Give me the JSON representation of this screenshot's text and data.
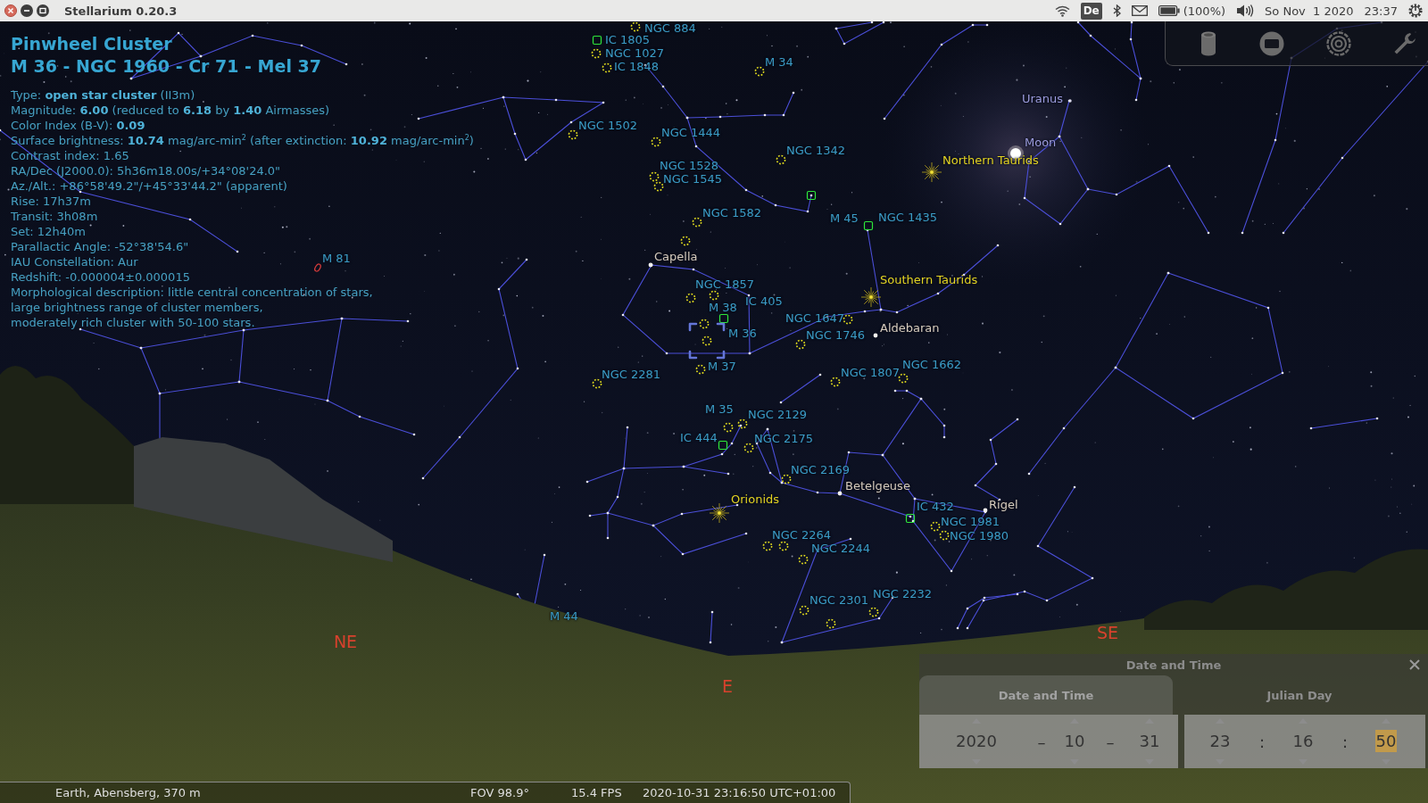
{
  "window": {
    "title": "Stellarium 0.20.3"
  },
  "system_tray": {
    "keyboard_layout": "De",
    "battery": "(100%)",
    "date": "So Nov  1 2020",
    "time": "23:37"
  },
  "object_info": {
    "title": "Pinwheel Cluster",
    "designations": "M 36 - NGC 1960 - Cr 71 - Mel 37",
    "lines": [
      "Type: **open star cluster** (II3m)",
      "Magnitude: **6.00** (reduced to **6.18** by **1.40** Airmasses)",
      "Color Index (B-V): **0.09**",
      "Surface brightness: **10.74** mag/arc-min$^{2}$ (after extinction: **10.92** mag/arc-min$^{2}$)",
      "Contrast index: 1.65",
      "RA/Dec (J2000.0): 5h36m18.00s/+34°08'24.0\"",
      "Az./Alt.: +86°58'49.2\"/+45°33'44.2\" (apparent)",
      "Rise: 17h37m",
      "Transit: 3h08m",
      "Set: 12h40m",
      "Parallactic Angle: -52°38'54.6\"",
      "IAU Constellation: Aur",
      "Redshift: -0.000004±0.000015",
      "Morphological description: little central concentration of stars,\nlarge brightness range of cluster members,\nmoderately rich cluster with 50-100 stars."
    ]
  },
  "sky_objects": [
    {
      "label": "NGC 884",
      "kind": "cluster",
      "selected": false
    },
    {
      "label": "IC 1805",
      "kind": "nebula",
      "selected": false
    },
    {
      "label": "NGC 1027",
      "kind": "cluster",
      "selected": false
    },
    {
      "label": "IC 1848",
      "kind": "cluster",
      "selected": false
    },
    {
      "label": "M 34",
      "kind": "cluster",
      "selected": false
    },
    {
      "label": "Uranus",
      "kind": "planet",
      "selected": false
    },
    {
      "label": "NGC 1502",
      "kind": "cluster",
      "selected": false
    },
    {
      "label": "NGC 1444",
      "kind": "cluster",
      "selected": false
    },
    {
      "label": "NGC 1342",
      "kind": "cluster",
      "selected": false
    },
    {
      "label": "Moon",
      "kind": "moon",
      "selected": false
    },
    {
      "label": "NGC 1528",
      "kind": "cluster",
      "selected": false
    },
    {
      "label": "Northern Taurids",
      "kind": "meteor_shower",
      "selected": false
    },
    {
      "label": "NGC 1545",
      "kind": "cluster",
      "selected": false
    },
    {
      "label": "NGC 1582",
      "kind": "cluster",
      "selected": false
    },
    {
      "label": "M 45",
      "kind": "nebula",
      "selected": false
    },
    {
      "label": "NGC 1435",
      "kind": "nebula",
      "selected": false
    },
    {
      "label": "M 81",
      "kind": "galaxy",
      "selected": false
    },
    {
      "label": "Capella",
      "kind": "star",
      "selected": false
    },
    {
      "label": "NGC 1857",
      "kind": "cluster",
      "selected": false
    },
    {
      "label": "Southern Taurids",
      "kind": "meteor_shower",
      "selected": false
    },
    {
      "label": "M 38",
      "kind": "cluster",
      "selected": false
    },
    {
      "label": "IC 405",
      "kind": "nebula",
      "selected": false
    },
    {
      "label": "NGC 1647",
      "kind": "cluster",
      "selected": false
    },
    {
      "label": "M 36",
      "kind": "cluster",
      "selected": true
    },
    {
      "label": "NGC 1746",
      "kind": "cluster",
      "selected": false
    },
    {
      "label": "Aldebaran",
      "kind": "star",
      "selected": false
    },
    {
      "label": "NGC 2281",
      "kind": "cluster",
      "selected": false
    },
    {
      "label": "M 37",
      "kind": "cluster",
      "selected": false
    },
    {
      "label": "NGC 1807",
      "kind": "cluster",
      "selected": false
    },
    {
      "label": "NGC 1662",
      "kind": "cluster",
      "selected": false
    },
    {
      "label": "M 35",
      "kind": "cluster",
      "selected": false
    },
    {
      "label": "NGC 2129",
      "kind": "cluster",
      "selected": false
    },
    {
      "label": "IC 444",
      "kind": "nebula",
      "selected": false
    },
    {
      "label": "NGC 2175",
      "kind": "cluster",
      "selected": false
    },
    {
      "label": "NGC 2169",
      "kind": "cluster",
      "selected": false
    },
    {
      "label": "Betelgeuse",
      "kind": "star",
      "selected": false
    },
    {
      "label": "Orionids",
      "kind": "meteor_shower",
      "selected": false
    },
    {
      "label": "IC 432",
      "kind": "nebula",
      "selected": false
    },
    {
      "label": "Rigel",
      "kind": "star",
      "selected": false
    },
    {
      "label": "NGC 1981",
      "kind": "cluster",
      "selected": false
    },
    {
      "label": "NGC 2264",
      "kind": "cluster",
      "selected": false
    },
    {
      "label": "NGC 1980",
      "kind": "cluster",
      "selected": false
    },
    {
      "label": "NGC 2244",
      "kind": "cluster",
      "selected": false
    },
    {
      "label": "NGC 2301",
      "kind": "cluster",
      "selected": false
    },
    {
      "label": "NGC 2232",
      "kind": "cluster",
      "selected": false
    },
    {
      "label": "M 44",
      "kind": "cluster",
      "selected": false
    }
  ],
  "cardinal_points": [
    "NE",
    "E",
    "SE"
  ],
  "date_time_dialog": {
    "title": "Date and Time",
    "tabs": [
      {
        "label": "Date and Time",
        "selected": true
      },
      {
        "label": "Julian Day",
        "selected": false
      }
    ],
    "date": {
      "fields": [
        {
          "value": "2020",
          "selected": false
        },
        {
          "value": "10",
          "selected": false
        },
        {
          "value": "31",
          "selected": false
        }
      ],
      "separators": [
        "–",
        "–"
      ]
    },
    "time": {
      "fields": [
        {
          "value": "23",
          "selected": false
        },
        {
          "value": "16",
          "selected": false
        },
        {
          "value": "50",
          "selected": true
        }
      ],
      "separators": [
        ":",
        ":"
      ]
    }
  },
  "status_bar": {
    "location": "Earth, Abensberg, 370 m",
    "fov": "FOV 98.9°",
    "fps": "15.4 FPS",
    "datetime": "2020-10-31 23:16:50 UTC+01:00"
  }
}
